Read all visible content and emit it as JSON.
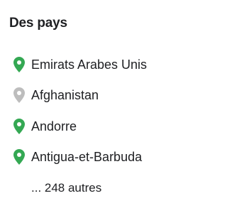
{
  "section": {
    "title": "Des pays"
  },
  "countries": [
    {
      "label": "Emirats Arabes Unis",
      "icon": "map-pin-icon",
      "pin_color": "#34a853"
    },
    {
      "label": "Afghanistan",
      "icon": "map-pin-icon",
      "pin_color": "#bdbdbd"
    },
    {
      "label": "Andorre",
      "icon": "map-pin-icon",
      "pin_color": "#34a853"
    },
    {
      "label": "Antigua-et-Barbuda",
      "icon": "map-pin-icon",
      "pin_color": "#34a853"
    }
  ],
  "more_link": {
    "label": "... 248 autres"
  }
}
